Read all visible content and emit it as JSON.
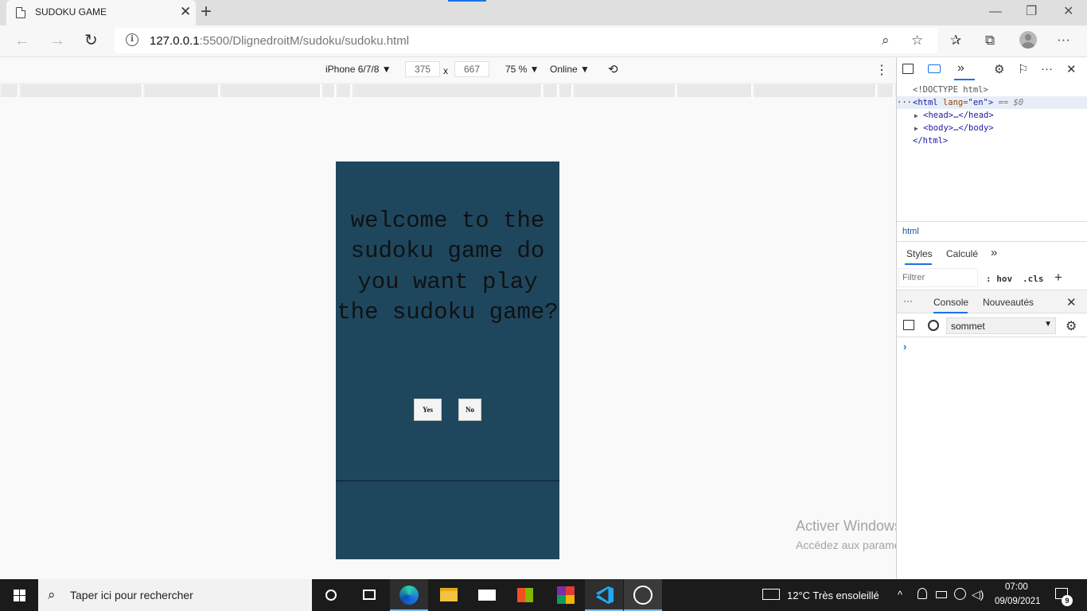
{
  "browser": {
    "tab_title": "SUDOKU GAME",
    "tab_close": "✕",
    "new_tab": "+",
    "url_host": "127.0.0.1",
    "url_rest": ":5500/DlignedroitM/sudoku/sudoku.html",
    "back": "←",
    "forward": "→",
    "refresh": "↻",
    "info": "i",
    "zoom_icon": "⌕",
    "fav_icon": "☆",
    "collections_icon": "⧉",
    "favorites_bar_icon": "✰",
    "more": "···",
    "minimize": "—",
    "restore": "❐",
    "close": "✕"
  },
  "device_toolbar": {
    "device": "iPhone 6/7/8 ▼",
    "width": "375",
    "times": "x",
    "height": "667",
    "zoom": "75 % ▼",
    "throttle": "Online ▼",
    "rotate": "⟲",
    "more": "⋮"
  },
  "page": {
    "welcome": "welcome to the sudoku game do you want play the sudoku game?",
    "yes_label": "Yes",
    "no_label": "No"
  },
  "watermark": {
    "title": "Activer Windows",
    "subtitle": "Accédez aux paramètres pour activer Windows."
  },
  "devtools": {
    "more_tabs": "»",
    "settings": "⚙",
    "feedback": "⚐",
    "dots": "···",
    "close": "✕",
    "dom": {
      "doctype": "<!DOCTYPE html>",
      "dots": "···",
      "html_open": "<html",
      "lang_name": " lang=",
      "lang_val": "\"en\"",
      "html_close_bracket": ">",
      "eq": " == $0",
      "head": "<head>…</head>",
      "body": "<body>…</body>",
      "html_end": "</html>",
      "arrow": "▶"
    },
    "breadcrumb": "html",
    "styles_tab": "Styles",
    "computed_tab": "Calculé",
    "more": "»",
    "filter_placeholder": "Filtrer",
    "hov": ": hov",
    "cls": ".cls",
    "plus": "+",
    "console_dots": "···",
    "console_tab": "Console",
    "whatsnew_tab": "Nouveautés",
    "console_close": "✕",
    "context": "sommet",
    "context_arrow": "▼",
    "prompt": "›"
  },
  "taskbar": {
    "search_placeholder": "Taper ici pour rechercher",
    "weather": "12°C  Très ensoleillé",
    "time": "07:00",
    "date": "09/09/2021",
    "notif_count": "9",
    "chevron": "^"
  },
  "colors": {
    "phone_bg": "#1e475e",
    "accent": "#1a73e8",
    "taskbar": "#1b1b1b"
  }
}
